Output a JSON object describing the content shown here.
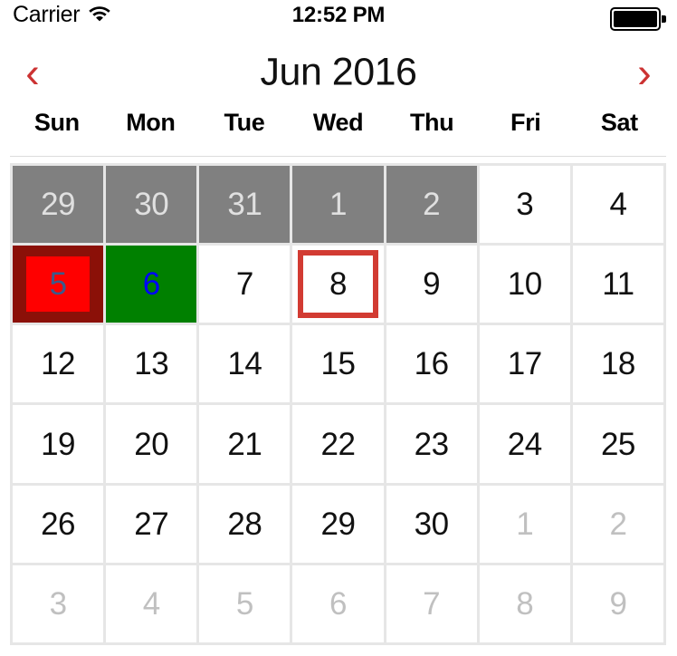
{
  "statusbar": {
    "carrier": "Carrier",
    "wifi_icon": "wifi-icon",
    "time": "12:52 PM",
    "battery_icon": "battery-full-icon"
  },
  "header": {
    "prev_label": "‹",
    "prev_icon": "chevron-left-icon",
    "next_label": "›",
    "next_icon": "chevron-right-icon",
    "month_title": "Jun 2016"
  },
  "weekdays": [
    "Sun",
    "Mon",
    "Tue",
    "Wed",
    "Thu",
    "Fri",
    "Sat"
  ],
  "colors": {
    "accent_red": "#CC3333",
    "selected_border": "#D23B32",
    "adjacent_gray_bg": "#808080",
    "adjacent_gray_text": "#E0E0E0",
    "faded_text": "#C0C0C0",
    "mark_red_outer": "#8B1008",
    "mark_red_inner": "#FF0000",
    "mark_red_text": "#3A5A8C",
    "mark_green_bg": "#008000",
    "mark_green_text": "#0000FF",
    "grid_line": "#E6E6E6",
    "cell_bg": "#FFFFFF",
    "text": "#111111"
  },
  "calendar": {
    "month": "Jun",
    "year": "2016",
    "rows": [
      [
        {
          "day": "29",
          "state": "other-gray"
        },
        {
          "day": "30",
          "state": "other-gray"
        },
        {
          "day": "31",
          "state": "other-gray"
        },
        {
          "day": "1",
          "state": "other-gray"
        },
        {
          "day": "2",
          "state": "other-gray"
        },
        {
          "day": "3",
          "state": "normal"
        },
        {
          "day": "4",
          "state": "normal"
        }
      ],
      [
        {
          "day": "5",
          "state": "mark-red"
        },
        {
          "day": "6",
          "state": "mark-green"
        },
        {
          "day": "7",
          "state": "normal"
        },
        {
          "day": "8",
          "state": "selected"
        },
        {
          "day": "9",
          "state": "normal"
        },
        {
          "day": "10",
          "state": "normal"
        },
        {
          "day": "11",
          "state": "normal"
        }
      ],
      [
        {
          "day": "12",
          "state": "normal"
        },
        {
          "day": "13",
          "state": "normal"
        },
        {
          "day": "14",
          "state": "normal"
        },
        {
          "day": "15",
          "state": "normal"
        },
        {
          "day": "16",
          "state": "normal"
        },
        {
          "day": "17",
          "state": "normal"
        },
        {
          "day": "18",
          "state": "normal"
        }
      ],
      [
        {
          "day": "19",
          "state": "normal"
        },
        {
          "day": "20",
          "state": "normal"
        },
        {
          "day": "21",
          "state": "normal"
        },
        {
          "day": "22",
          "state": "normal"
        },
        {
          "day": "23",
          "state": "normal"
        },
        {
          "day": "24",
          "state": "normal"
        },
        {
          "day": "25",
          "state": "normal"
        }
      ],
      [
        {
          "day": "26",
          "state": "normal"
        },
        {
          "day": "27",
          "state": "normal"
        },
        {
          "day": "28",
          "state": "normal"
        },
        {
          "day": "29",
          "state": "normal"
        },
        {
          "day": "30",
          "state": "normal"
        },
        {
          "day": "1",
          "state": "other-faded"
        },
        {
          "day": "2",
          "state": "other-faded"
        }
      ],
      [
        {
          "day": "3",
          "state": "other-faded"
        },
        {
          "day": "4",
          "state": "other-faded"
        },
        {
          "day": "5",
          "state": "other-faded"
        },
        {
          "day": "6",
          "state": "other-faded"
        },
        {
          "day": "7",
          "state": "other-faded"
        },
        {
          "day": "8",
          "state": "other-faded"
        },
        {
          "day": "9",
          "state": "other-faded"
        }
      ]
    ]
  }
}
